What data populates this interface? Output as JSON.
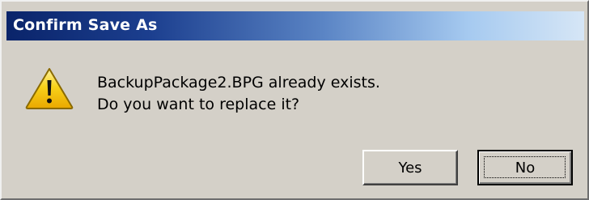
{
  "dialog": {
    "title": "Confirm Save As",
    "icon": "warning-icon",
    "message_line1": "BackupPackage2.BPG already exists.",
    "message_line2": "Do you want to replace it?"
  },
  "buttons": {
    "yes_label": "Yes",
    "no_label": "No",
    "default": "No"
  },
  "colors": {
    "titlebar_start": "#0a246a",
    "titlebar_end": "#d6e6f6",
    "dialog_background": "#d4d0c8",
    "warning_yellow": "#f5c400"
  }
}
